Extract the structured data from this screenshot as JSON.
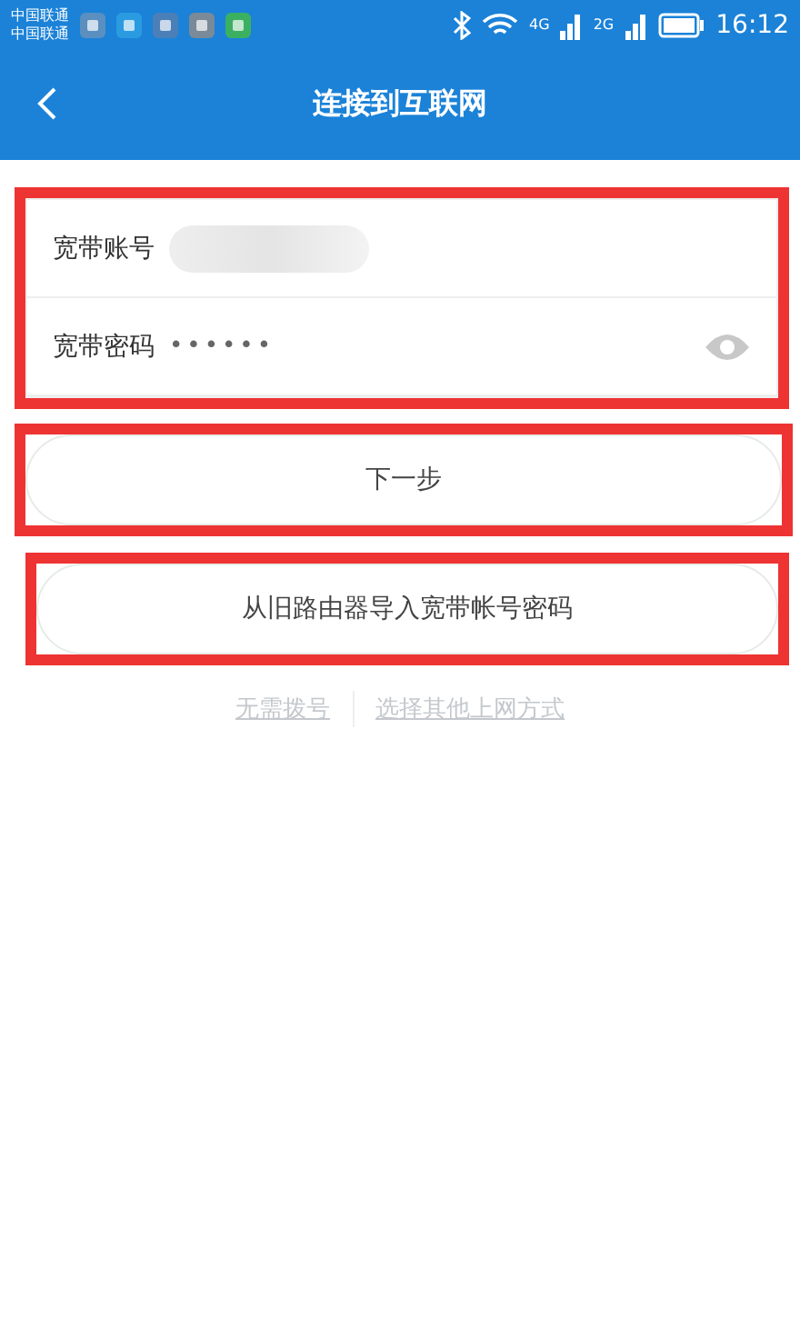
{
  "status_bar": {
    "carriers": [
      "中国联通",
      "中国联通"
    ],
    "network_labels": [
      "4G",
      "2G"
    ],
    "time": "16:12"
  },
  "header": {
    "title": "连接到互联网"
  },
  "form": {
    "highlighted": true,
    "fields": [
      {
        "kind": "account",
        "label": "宽带账号"
      },
      {
        "kind": "password",
        "label": "宽带密码",
        "value": "••••••"
      }
    ]
  },
  "buttons": [
    {
      "label": "下一步",
      "highlighted": true
    },
    {
      "label": "从旧路由器导入宽带帐号密码",
      "highlighted": true
    }
  ],
  "links": [
    "无需拨号",
    "选择其他上网方式"
  ]
}
